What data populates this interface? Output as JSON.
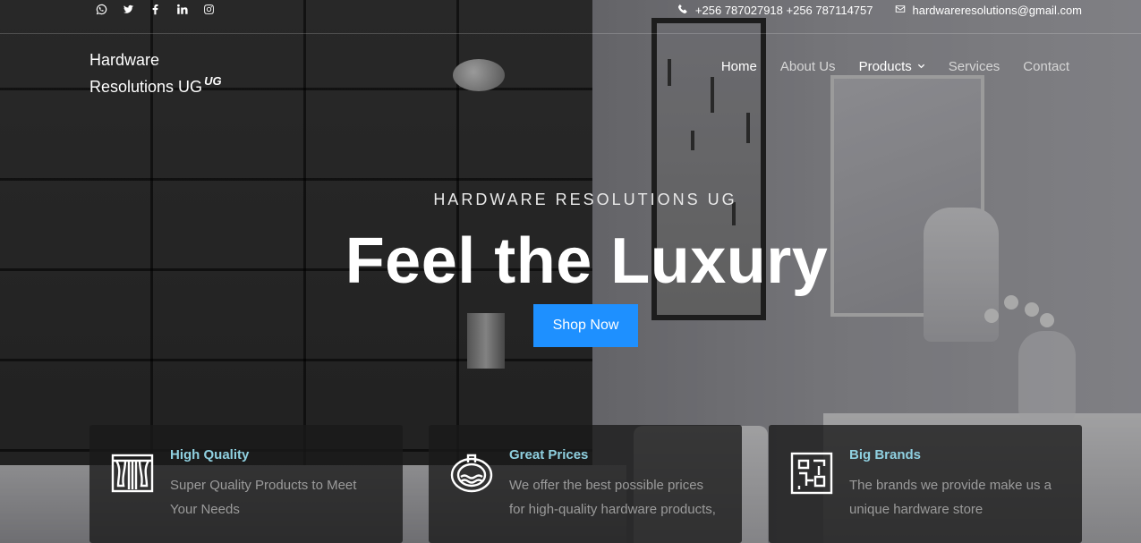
{
  "topbar": {
    "social_icons": [
      "whatsapp-icon",
      "twitter-icon",
      "facebook-icon",
      "linkedin-icon",
      "instagram-icon"
    ],
    "phone": "+256 787027918 +256 787114757",
    "email": "hardwareresolutions@gmail.com"
  },
  "brand": {
    "line1": "Hardware",
    "line2": "Resolutions UG",
    "suffix": "UG"
  },
  "nav": {
    "home": "Home",
    "about": "About Us",
    "products": "Products",
    "services": "Services",
    "contact": "Contact"
  },
  "hero": {
    "kicker": "HARDWARE RESOLUTIONS UG",
    "title": "Feel the Luxury",
    "cta": "Shop Now"
  },
  "features": [
    {
      "title": "High Quality",
      "text": "Super Quality Products to Meet Your Needs",
      "icon": "curtain-icon"
    },
    {
      "title": "Great Prices",
      "text": "We offer the best possible prices for high-quality hardware products,",
      "icon": "bathtub-icon"
    },
    {
      "title": "Big Brands",
      "text": "The brands we provide make us a unique hardware store",
      "icon": "floor-plan-icon"
    }
  ],
  "colors": {
    "accent": "#1e90ff",
    "feature_title": "#8fd0e0",
    "feature_text": "#9b9b9b"
  }
}
